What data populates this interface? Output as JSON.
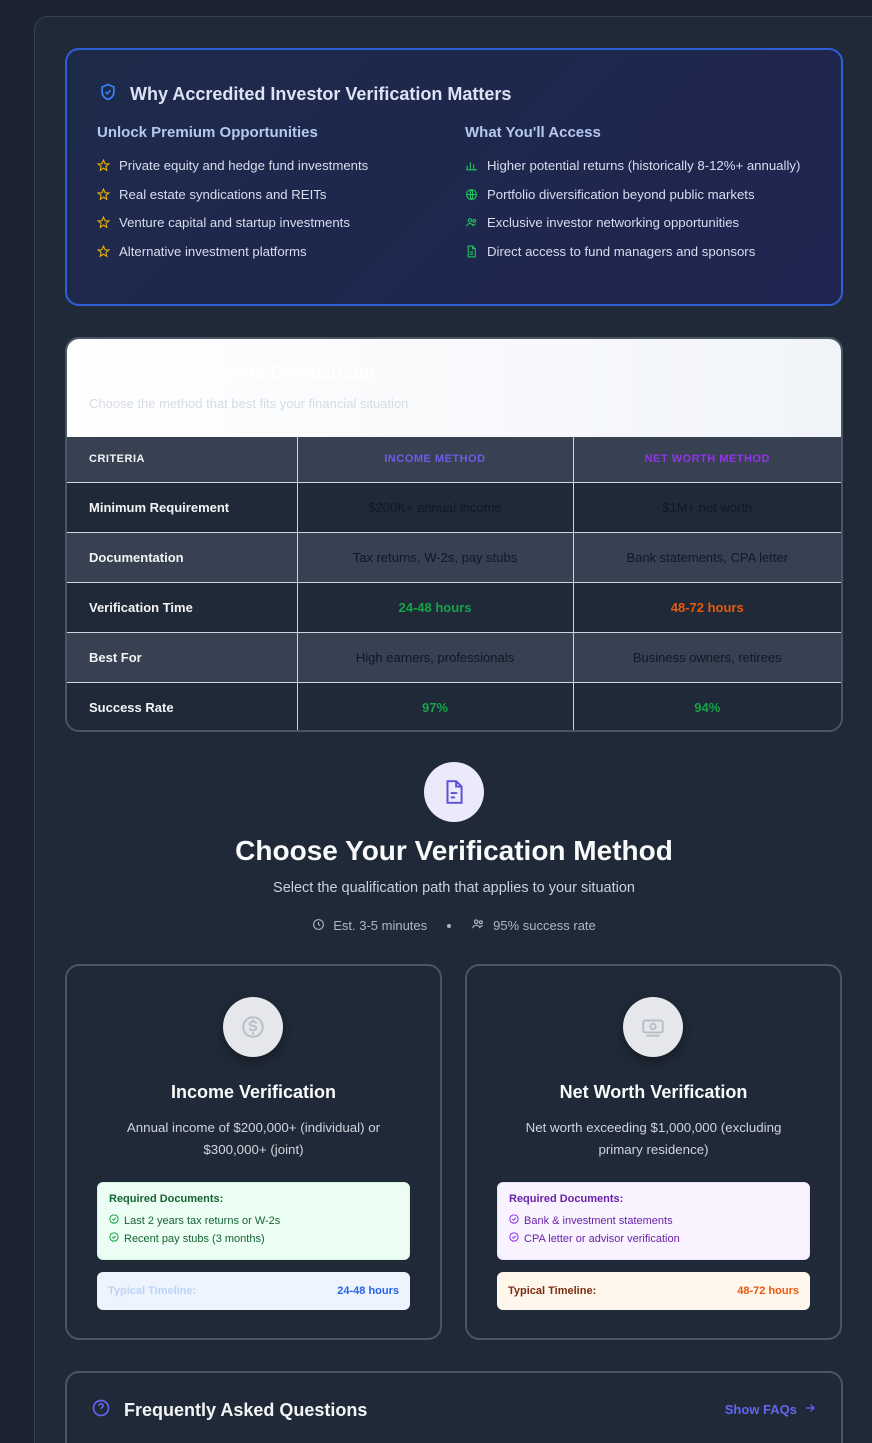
{
  "why": {
    "title": "Why Accredited Investor Verification Matters",
    "left": {
      "heading": "Unlock Premium Opportunities",
      "items": [
        "Private equity and hedge fund investments",
        "Real estate syndications and REITs",
        "Venture capital and startup investments",
        "Alternative investment platforms"
      ]
    },
    "right": {
      "heading": "What You'll Access",
      "items": [
        "Higher potential returns (historically 8-12%+ annually)",
        "Portfolio diversification beyond public markets",
        "Exclusive investor networking opportunities",
        "Direct access to fund managers and sponsors"
      ]
    }
  },
  "comparison": {
    "title": "Verification Methods Comparison",
    "subtitle": "Choose the method that best fits your financial situation",
    "headers": [
      "Criteria",
      "Income Method",
      "Net Worth Method"
    ],
    "rows": [
      {
        "label": "Minimum Requirement",
        "income": "$200K+ annual income",
        "networth": "$1M+ net worth"
      },
      {
        "label": "Documentation",
        "income": "Tax returns, W-2s, pay stubs",
        "networth": "Bank statements, CPA letter"
      },
      {
        "label": "Verification Time",
        "income": "24-48 hours",
        "networth": "48-72 hours"
      },
      {
        "label": "Best For",
        "income": "High earners, professionals",
        "networth": "Business owners, retirees"
      },
      {
        "label": "Success Rate",
        "income": "97%",
        "networth": "94%"
      }
    ]
  },
  "choose": {
    "title": "Choose Your Verification Method",
    "subtitle": "Select the qualification path that applies to your situation",
    "est_time": "Est. 3-5 minutes",
    "success": "95% success rate"
  },
  "income_card": {
    "title": "Income Verification",
    "desc": "Annual income of $200,000+ (individual) or $300,000+ (joint)",
    "req_heading": "Required Documents:",
    "req_items": [
      "Last 2 years tax returns or W-2s",
      "Recent pay stubs (3 months)"
    ],
    "timeline_label": "Typical Timeline:",
    "timeline_value": "24-48 hours"
  },
  "networth_card": {
    "title": "Net Worth Verification",
    "desc": "Net worth exceeding $1,000,000 (excluding primary residence)",
    "req_heading": "Required Documents:",
    "req_items": [
      "Bank & investment statements",
      "CPA letter or advisor verification"
    ],
    "timeline_label": "Typical Timeline:",
    "timeline_value": "48-72 hours"
  },
  "faq": {
    "title": "Frequently Asked Questions",
    "toggle": "Show FAQs"
  }
}
